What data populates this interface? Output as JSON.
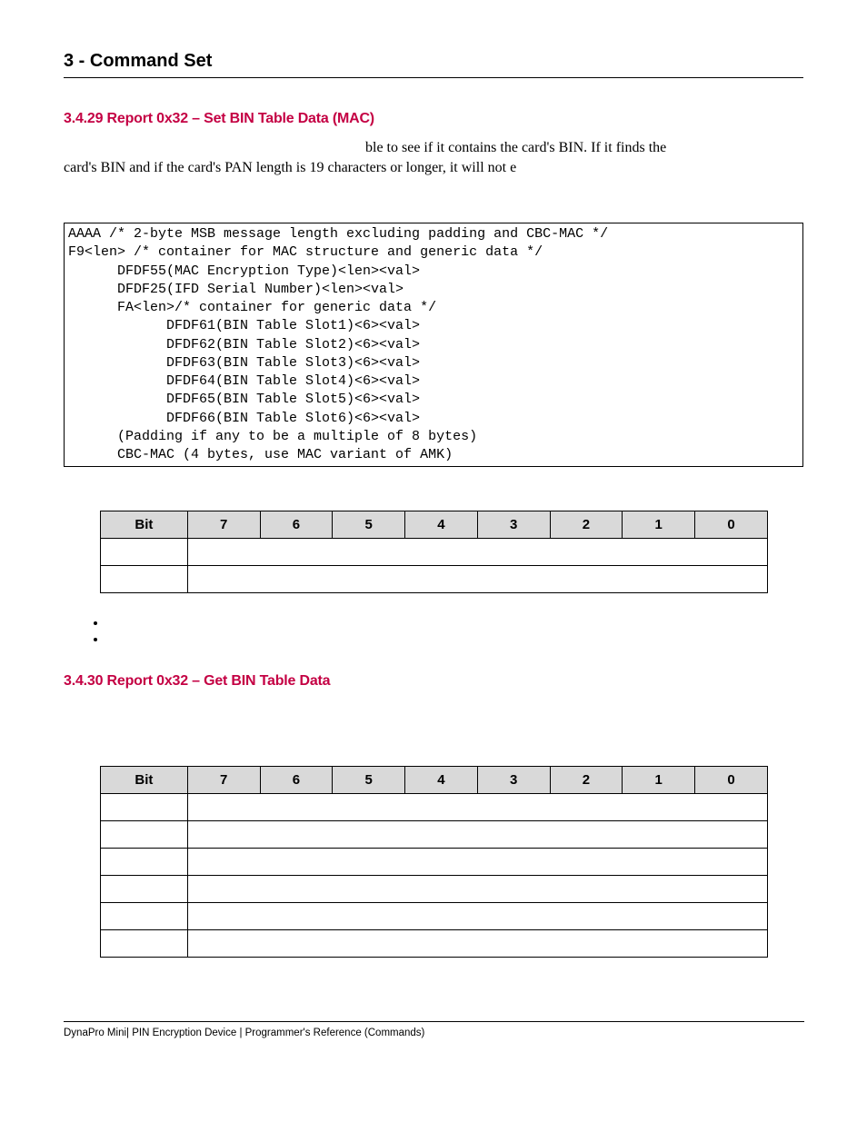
{
  "header": {
    "title": "3 - Command Set"
  },
  "sections": {
    "s1": {
      "heading": "3.4.29 Report 0x32 – Set BIN Table Data (MAC)",
      "para_frag1": "ble to see if it contains the card's BIN.  If it finds the",
      "para_frag2": "card's BIN and if the card's PAN length is 19 characters or longer, it will not e",
      "codeblock": "AAAA /* 2-byte MSB message length excluding padding and CBC-MAC */\nF9<len> /* container for MAC structure and generic data */\n      DFDF55(MAC Encryption Type)<len><val>\n      DFDF25(IFD Serial Number)<len><val>\n      FA<len>/* container for generic data */\n            DFDF61(BIN Table Slot1)<6><val>\n            DFDF62(BIN Table Slot2)<6><val>\n            DFDF63(BIN Table Slot3)<6><val>\n            DFDF64(BIN Table Slot4)<6><val>\n            DFDF65(BIN Table Slot5)<6><val>\n            DFDF66(BIN Table Slot6)<6><val>\n      (Padding if any to be a multiple of 8 bytes)\n      CBC-MAC (4 bytes, use MAC variant of AMK)"
    },
    "table1": {
      "headers": [
        "Bit",
        "7",
        "6",
        "5",
        "4",
        "3",
        "2",
        "1",
        "0"
      ],
      "body_rows": 2
    },
    "s2": {
      "heading": "3.4.30 Report 0x32 – Get BIN Table Data"
    },
    "table2": {
      "headers": [
        "Bit",
        "7",
        "6",
        "5",
        "4",
        "3",
        "2",
        "1",
        "0"
      ],
      "body_rows": 6
    }
  },
  "footer": "DynaPro Mini| PIN Encryption Device | Programmer's Reference (Commands)"
}
